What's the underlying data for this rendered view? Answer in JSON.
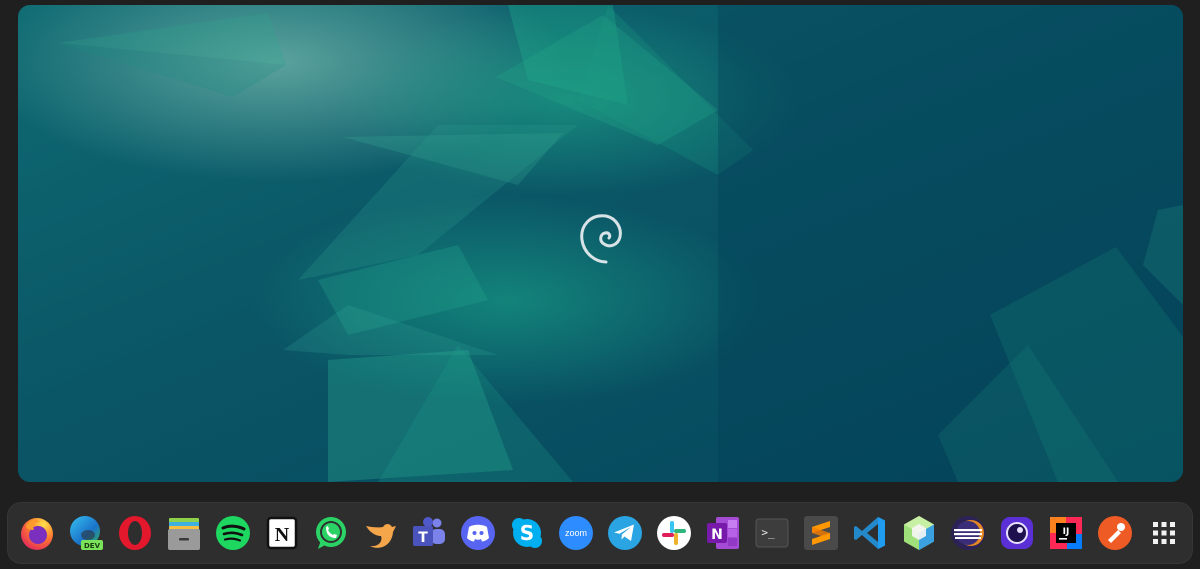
{
  "dock": {
    "items": [
      {
        "id": "firefox",
        "icon": "firefox-icon"
      },
      {
        "id": "edge-dev",
        "icon": "edge-dev-icon",
        "badge": "DEV"
      },
      {
        "id": "opera",
        "icon": "opera-icon"
      },
      {
        "id": "files",
        "icon": "files-icon"
      },
      {
        "id": "spotify",
        "icon": "spotify-icon"
      },
      {
        "id": "notion",
        "icon": "notion-icon",
        "glyph": "N"
      },
      {
        "id": "whatsapp",
        "icon": "whatsapp-icon"
      },
      {
        "id": "bird-client",
        "icon": "bird-icon"
      },
      {
        "id": "teams",
        "icon": "teams-icon",
        "glyph": "T"
      },
      {
        "id": "discord",
        "icon": "discord-icon"
      },
      {
        "id": "skype",
        "icon": "skype-icon",
        "glyph": "S"
      },
      {
        "id": "zoom",
        "icon": "zoom-icon",
        "glyph": "zoom"
      },
      {
        "id": "telegram",
        "icon": "telegram-icon"
      },
      {
        "id": "slack",
        "icon": "slack-icon"
      },
      {
        "id": "onenote",
        "icon": "onenote-icon",
        "glyph": "N"
      },
      {
        "id": "terminal",
        "icon": "terminal-icon",
        "glyph": ">_"
      },
      {
        "id": "sublime-text",
        "icon": "sublime-text-icon"
      },
      {
        "id": "vscode",
        "icon": "vscode-icon"
      },
      {
        "id": "netbeans",
        "icon": "netbeans-icon"
      },
      {
        "id": "eclipse",
        "icon": "eclipse-icon"
      },
      {
        "id": "screen-recorder",
        "icon": "screen-recorder-icon"
      },
      {
        "id": "intellij",
        "icon": "intellij-icon",
        "glyph": "IJ"
      },
      {
        "id": "postman",
        "icon": "postman-icon"
      },
      {
        "id": "app-grid",
        "icon": "app-grid-icon"
      }
    ]
  },
  "colors": {
    "wallpaper_base": "#064a5e",
    "wallpaper_accent": "#1fa085",
    "dock_bg": "#2e2e2e",
    "screen_bg": "#1f1f1f"
  }
}
